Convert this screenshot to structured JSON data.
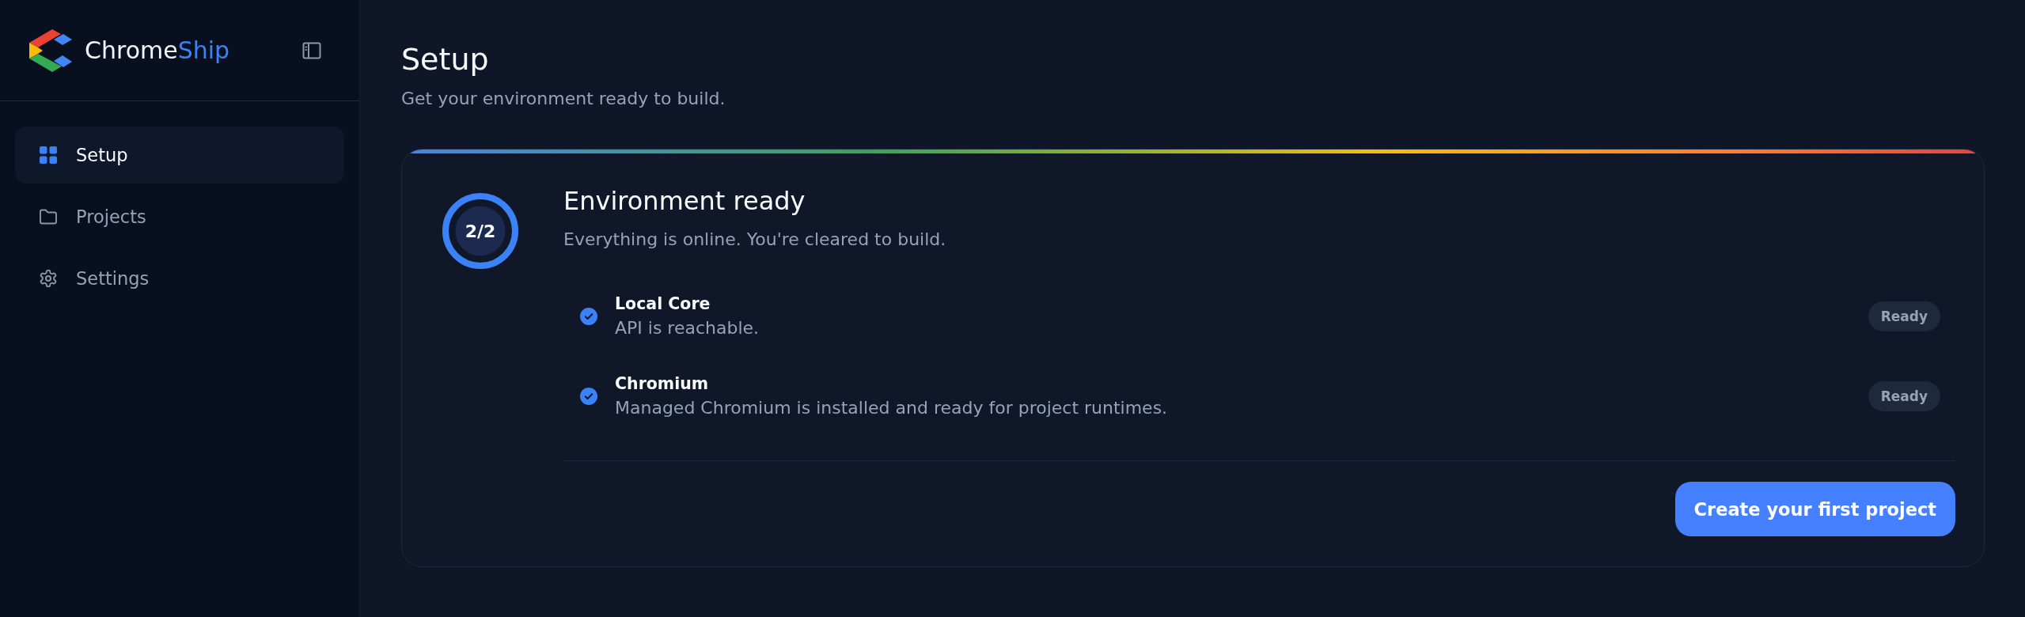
{
  "sidebar": {
    "brand": {
      "text": "Chrome",
      "accent": "Ship"
    },
    "nav_items": [
      {
        "label": "Setup",
        "selected": true
      },
      {
        "label": "Projects",
        "selected": false
      },
      {
        "label": "Settings",
        "selected": false
      }
    ]
  },
  "page": {
    "title": "Setup",
    "subtitle": "Get your environment ready to build."
  },
  "card": {
    "progress": {
      "text": "2/2",
      "level": 1
    },
    "title": "Environment ready",
    "subtitle": "Everything is online. You're cleared to build.",
    "checks": [
      {
        "name": "Local Core",
        "description": "API is reachable.",
        "status": "Ready",
        "done": true
      },
      {
        "name": "Chromium",
        "description": "Managed Chromium is installed and ready for project runtimes.",
        "status": "Ready",
        "done": true
      }
    ],
    "button": "Create your first project"
  }
}
